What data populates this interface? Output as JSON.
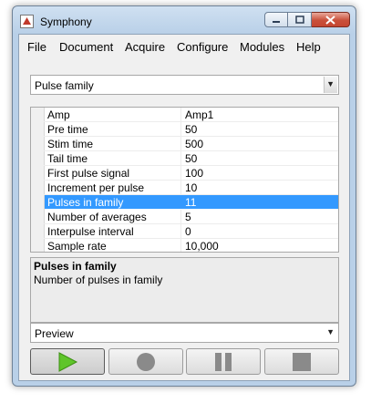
{
  "window": {
    "title": "Symphony"
  },
  "menu": [
    "File",
    "Document",
    "Acquire",
    "Configure",
    "Modules",
    "Help"
  ],
  "protocol_select": {
    "value": "Pulse family"
  },
  "properties": [
    {
      "name": "Amp",
      "value": "Amp1"
    },
    {
      "name": "Pre time",
      "value": "50"
    },
    {
      "name": "Stim time",
      "value": "500"
    },
    {
      "name": "Tail time",
      "value": "50"
    },
    {
      "name": "First pulse signal",
      "value": "100"
    },
    {
      "name": "Increment per pulse",
      "value": "10"
    },
    {
      "name": "Pulses in family",
      "value": "11",
      "selected": true
    },
    {
      "name": "Number of averages",
      "value": "5"
    },
    {
      "name": "Interpulse interval",
      "value": "0"
    },
    {
      "name": "Sample rate",
      "value": "10,000"
    }
  ],
  "description": {
    "title": "Pulses in family",
    "text": "Number of pulses in family"
  },
  "mode_select": {
    "value": "Preview"
  },
  "controls": [
    {
      "name": "play-icon",
      "color": "#4caf1f"
    },
    {
      "name": "record-icon",
      "color": "#8a8a8a"
    },
    {
      "name": "pause-icon",
      "color": "#8a8a8a"
    },
    {
      "name": "stop-icon",
      "color": "#8a8a8a"
    }
  ],
  "colors": {
    "selection": "#3399ff",
    "accent": "#4caf1f"
  }
}
